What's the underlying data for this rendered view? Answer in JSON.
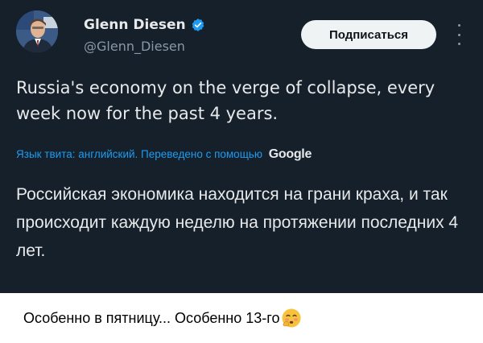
{
  "tweet": {
    "author": {
      "name": "Glenn Diesen",
      "handle": "@Glenn_Diesen",
      "avatar_icon": "avatar-photo",
      "verified_icon": "verified-badge-icon"
    },
    "subscribe_label": "Подписаться",
    "more_icon": "vertical-dots-icon",
    "text": "Russia's economy on the verge of collapse, every week now for the past 4 years.",
    "translation": {
      "note": "Язык твита: английский. Переведено с помощью",
      "provider": "Google"
    },
    "translated_text": "Российская экономика находится на грани краха, и так происходит каждую неделю на протяжении последних 4 лет."
  },
  "caption": {
    "text": "Особенно в пятницу... Особенно 13-го",
    "emoji_icon": "blushing-face-emoji"
  },
  "colors": {
    "card_background": "#15202b",
    "text_primary": "#e7e9ea",
    "text_secondary": "#8b98a5",
    "link": "#1d9bf0",
    "verified": "#1d9bf0",
    "button_background": "#eff3f4",
    "page_background": "#ffffff"
  }
}
